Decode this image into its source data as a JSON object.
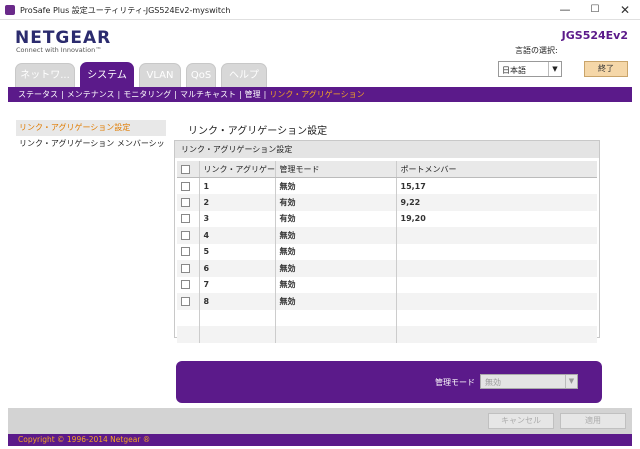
{
  "window": {
    "title": "ProSafe Plus 設定ユーティリティ-JGS524Ev2-myswitch",
    "minimize": "—",
    "maximize": "☐",
    "close": "✕"
  },
  "header": {
    "logo": "NETGEAR",
    "tagline": "Connect with Innovation™",
    "model": "JGS524Ev2",
    "language_label": "言語の選択:",
    "language_value": "日本語",
    "logout_label": "終了"
  },
  "tabs": [
    {
      "label": "ネットワ..."
    },
    {
      "label": "システム",
      "active": true
    },
    {
      "label": "VLAN"
    },
    {
      "label": "QoS"
    },
    {
      "label": "ヘルプ"
    }
  ],
  "subnav": {
    "items": [
      "ステータス",
      "メンテナンス",
      "モニタリング",
      "マルチキャスト",
      "管理",
      "リンク・アグリゲーション"
    ],
    "active_index": 5,
    "separator": "|"
  },
  "leftnav": {
    "items": [
      {
        "label": "リンク・アグリゲーション設定",
        "active": true
      },
      {
        "label": "リンク・アグリゲーション メンバーシッ",
        "active": false
      }
    ]
  },
  "main": {
    "heading": "リンク・アグリゲーション設定",
    "panel_title": "リンク・アグリゲーション設定",
    "columns": [
      "リンク・アグリゲーシ",
      "管理モード",
      "ポートメンバー"
    ],
    "rows": [
      {
        "id": "1",
        "mode": "無効",
        "members": "15,17"
      },
      {
        "id": "2",
        "mode": "有効",
        "members": "9,22"
      },
      {
        "id": "3",
        "mode": "有効",
        "members": "19,20"
      },
      {
        "id": "4",
        "mode": "無効",
        "members": ""
      },
      {
        "id": "5",
        "mode": "無効",
        "members": ""
      },
      {
        "id": "6",
        "mode": "無効",
        "members": ""
      },
      {
        "id": "7",
        "mode": "無効",
        "members": ""
      },
      {
        "id": "8",
        "mode": "無効",
        "members": ""
      }
    ],
    "mgmt_mode_label": "管理モード",
    "mgmt_mode_value": "無効"
  },
  "footer": {
    "cancel_label": "キャンセル",
    "apply_label": "適用",
    "copyright": "Copyright © 1996-2014 Netgear ®"
  },
  "colors": {
    "brand_purple": "#5b1a8a",
    "accent_orange": "#f5a623"
  }
}
